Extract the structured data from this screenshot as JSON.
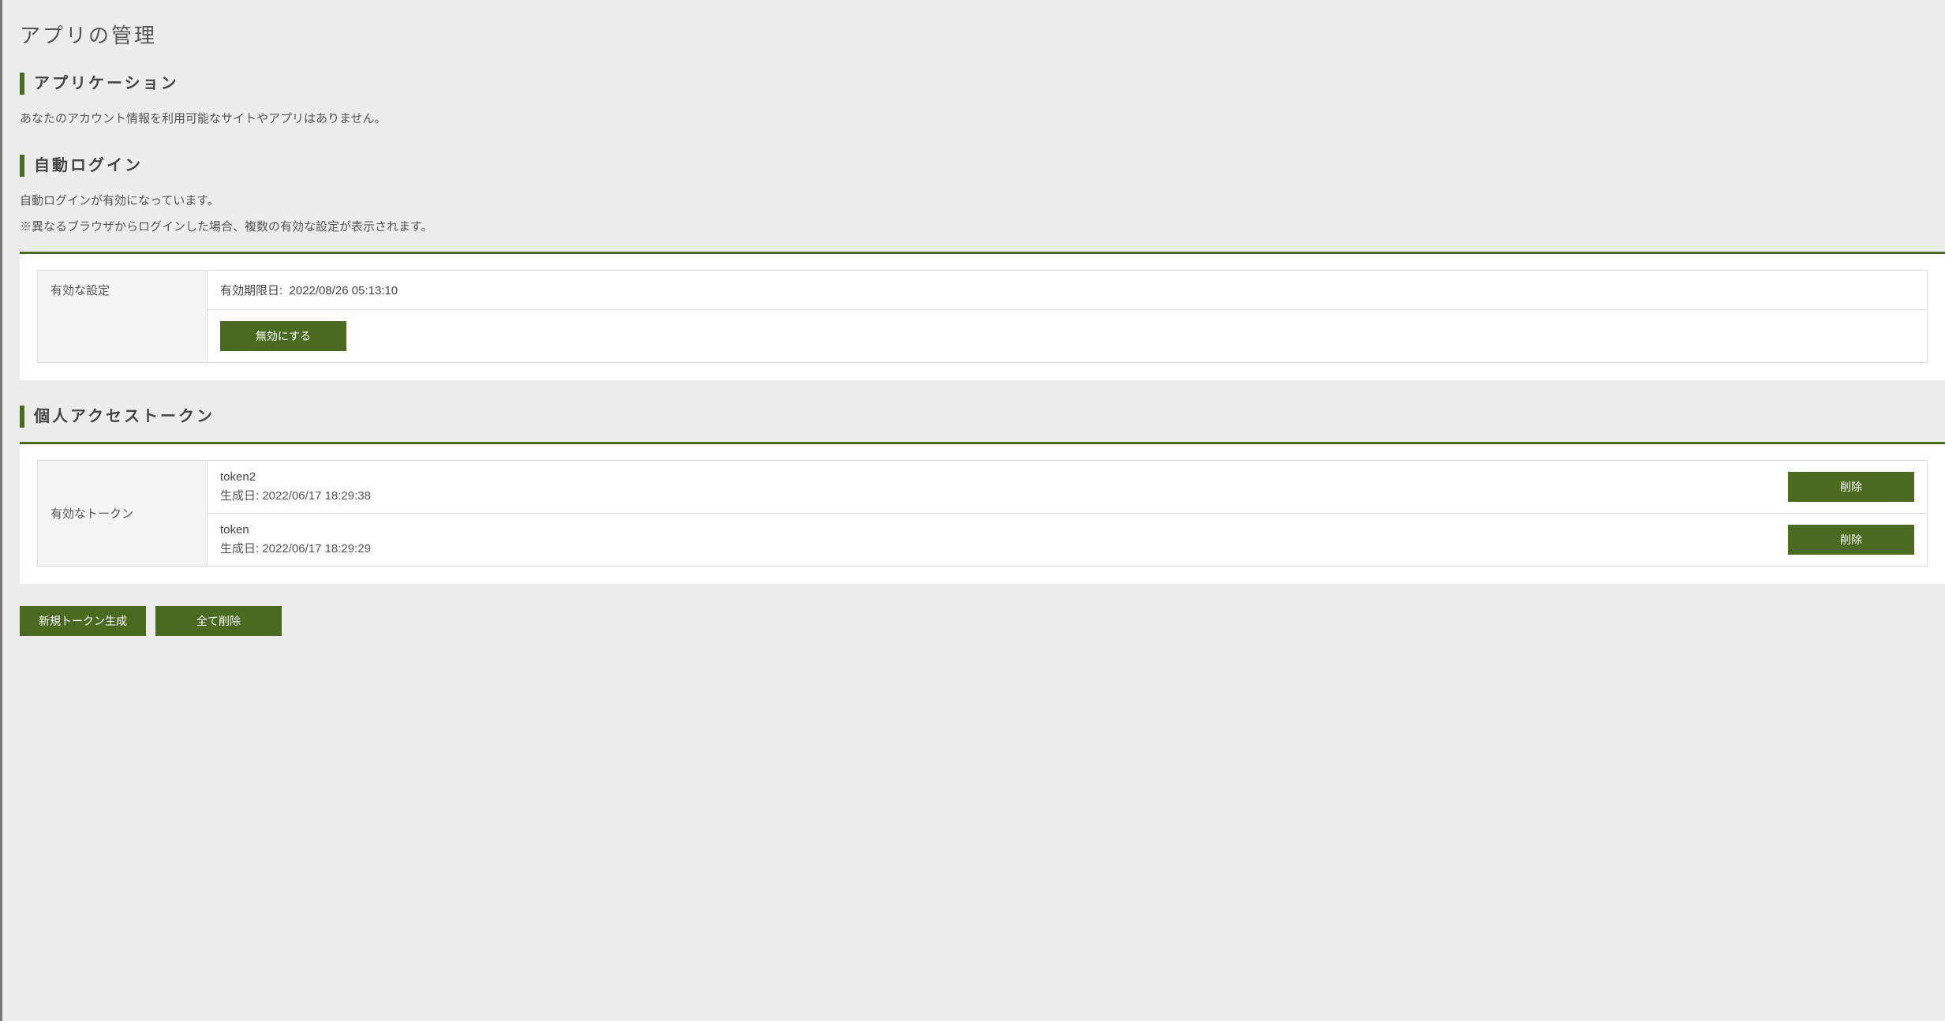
{
  "page": {
    "title": "アプリの管理"
  },
  "application": {
    "header": "アプリケーション",
    "message": "あなたのアカウント情報を利用可能なサイトやアプリはありません。"
  },
  "autologin": {
    "header": "自動ログイン",
    "message1": "自動ログインが有効になっています。",
    "message2": "※異なるブラウザからログインした場合、複数の有効な設定が表示されます。",
    "row_label": "有効な設定",
    "expiry_label": "有効期限日:",
    "expiry_value": "2022/08/26 05:13:10",
    "disable_button": "無効にする"
  },
  "tokens": {
    "header": "個人アクセストークン",
    "row_label": "有効なトークン",
    "created_label": "生成日:",
    "items": [
      {
        "name": "token2",
        "created": "2022/06/17 18:29:38"
      },
      {
        "name": "token",
        "created": "2022/06/17 18:29:29"
      }
    ],
    "delete_button": "削除",
    "new_button": "新規トークン生成",
    "delete_all_button": "全て削除"
  }
}
